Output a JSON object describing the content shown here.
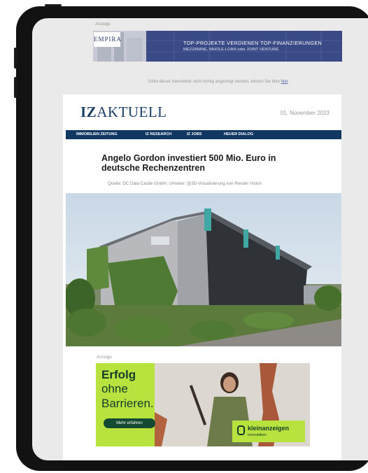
{
  "ad_top": {
    "label": "Anzeige",
    "brand": "EMPIRA",
    "line1": "TOP-PROJEKTE VERDIENEN TOP-FINANZIERUNGEN",
    "line2": "MEZZANINE, WHOLE-LOAN oder JOINT VENTURE"
  },
  "notice": {
    "text": "Sollte dieser Newsletter nicht richtig angezeigt werden, klicken Sie bitte",
    "link": "hier",
    "end": "."
  },
  "header": {
    "brand_bold": "IZ",
    "brand_rest": "AKTUELL",
    "date": "01. November 2023"
  },
  "nav": [
    "IMMOBILIEN ZEITUNG",
    "IZ RESEARCH",
    "IZ JOBS",
    "HEUER DIALOG"
  ],
  "article": {
    "headline": "Angelo Gordon investiert 500 Mio. Euro in deutsche Rechenzentren",
    "source": "Quelle: DC Data Castle GmbH, Urheber: @3D-Visualisierung von Render Vision"
  },
  "ad_bottom": {
    "label": "Anzeige",
    "line1": "Erfolg",
    "line2": "ohne",
    "line3": "Barrieren.",
    "button": "Mehr erfahren",
    "brand": "kleinanzeigen",
    "brand_sub": "Immobilien"
  },
  "colors": {
    "brand_blue": "#1e3f69",
    "nav_blue": "#113763",
    "ad_green": "#b8e23d",
    "empira_blue": "#3a4a86"
  }
}
